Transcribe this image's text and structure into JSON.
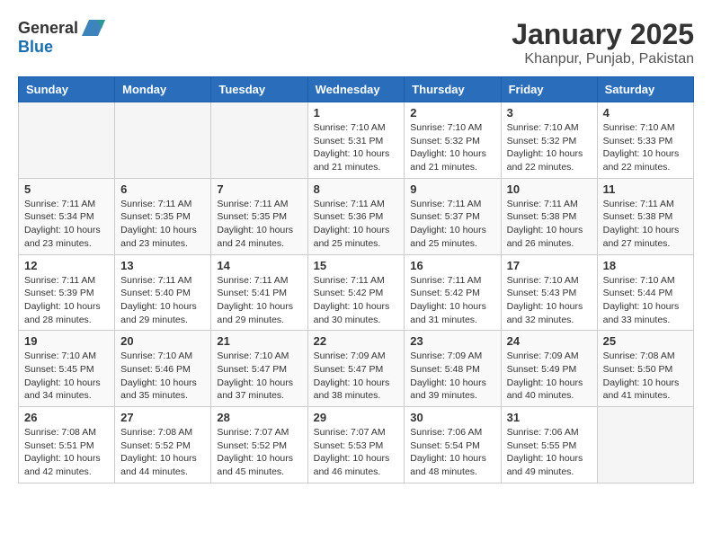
{
  "header": {
    "logo_general": "General",
    "logo_blue": "Blue",
    "title": "January 2025",
    "subtitle": "Khanpur, Punjab, Pakistan"
  },
  "weekdays": [
    "Sunday",
    "Monday",
    "Tuesday",
    "Wednesday",
    "Thursday",
    "Friday",
    "Saturday"
  ],
  "weeks": [
    [
      {
        "day": "",
        "info": ""
      },
      {
        "day": "",
        "info": ""
      },
      {
        "day": "",
        "info": ""
      },
      {
        "day": "1",
        "info": "Sunrise: 7:10 AM\nSunset: 5:31 PM\nDaylight: 10 hours\nand 21 minutes."
      },
      {
        "day": "2",
        "info": "Sunrise: 7:10 AM\nSunset: 5:32 PM\nDaylight: 10 hours\nand 21 minutes."
      },
      {
        "day": "3",
        "info": "Sunrise: 7:10 AM\nSunset: 5:32 PM\nDaylight: 10 hours\nand 22 minutes."
      },
      {
        "day": "4",
        "info": "Sunrise: 7:10 AM\nSunset: 5:33 PM\nDaylight: 10 hours\nand 22 minutes."
      }
    ],
    [
      {
        "day": "5",
        "info": "Sunrise: 7:11 AM\nSunset: 5:34 PM\nDaylight: 10 hours\nand 23 minutes."
      },
      {
        "day": "6",
        "info": "Sunrise: 7:11 AM\nSunset: 5:35 PM\nDaylight: 10 hours\nand 23 minutes."
      },
      {
        "day": "7",
        "info": "Sunrise: 7:11 AM\nSunset: 5:35 PM\nDaylight: 10 hours\nand 24 minutes."
      },
      {
        "day": "8",
        "info": "Sunrise: 7:11 AM\nSunset: 5:36 PM\nDaylight: 10 hours\nand 25 minutes."
      },
      {
        "day": "9",
        "info": "Sunrise: 7:11 AM\nSunset: 5:37 PM\nDaylight: 10 hours\nand 25 minutes."
      },
      {
        "day": "10",
        "info": "Sunrise: 7:11 AM\nSunset: 5:38 PM\nDaylight: 10 hours\nand 26 minutes."
      },
      {
        "day": "11",
        "info": "Sunrise: 7:11 AM\nSunset: 5:38 PM\nDaylight: 10 hours\nand 27 minutes."
      }
    ],
    [
      {
        "day": "12",
        "info": "Sunrise: 7:11 AM\nSunset: 5:39 PM\nDaylight: 10 hours\nand 28 minutes."
      },
      {
        "day": "13",
        "info": "Sunrise: 7:11 AM\nSunset: 5:40 PM\nDaylight: 10 hours\nand 29 minutes."
      },
      {
        "day": "14",
        "info": "Sunrise: 7:11 AM\nSunset: 5:41 PM\nDaylight: 10 hours\nand 29 minutes."
      },
      {
        "day": "15",
        "info": "Sunrise: 7:11 AM\nSunset: 5:42 PM\nDaylight: 10 hours\nand 30 minutes."
      },
      {
        "day": "16",
        "info": "Sunrise: 7:11 AM\nSunset: 5:42 PM\nDaylight: 10 hours\nand 31 minutes."
      },
      {
        "day": "17",
        "info": "Sunrise: 7:10 AM\nSunset: 5:43 PM\nDaylight: 10 hours\nand 32 minutes."
      },
      {
        "day": "18",
        "info": "Sunrise: 7:10 AM\nSunset: 5:44 PM\nDaylight: 10 hours\nand 33 minutes."
      }
    ],
    [
      {
        "day": "19",
        "info": "Sunrise: 7:10 AM\nSunset: 5:45 PM\nDaylight: 10 hours\nand 34 minutes."
      },
      {
        "day": "20",
        "info": "Sunrise: 7:10 AM\nSunset: 5:46 PM\nDaylight: 10 hours\nand 35 minutes."
      },
      {
        "day": "21",
        "info": "Sunrise: 7:10 AM\nSunset: 5:47 PM\nDaylight: 10 hours\nand 37 minutes."
      },
      {
        "day": "22",
        "info": "Sunrise: 7:09 AM\nSunset: 5:47 PM\nDaylight: 10 hours\nand 38 minutes."
      },
      {
        "day": "23",
        "info": "Sunrise: 7:09 AM\nSunset: 5:48 PM\nDaylight: 10 hours\nand 39 minutes."
      },
      {
        "day": "24",
        "info": "Sunrise: 7:09 AM\nSunset: 5:49 PM\nDaylight: 10 hours\nand 40 minutes."
      },
      {
        "day": "25",
        "info": "Sunrise: 7:08 AM\nSunset: 5:50 PM\nDaylight: 10 hours\nand 41 minutes."
      }
    ],
    [
      {
        "day": "26",
        "info": "Sunrise: 7:08 AM\nSunset: 5:51 PM\nDaylight: 10 hours\nand 42 minutes."
      },
      {
        "day": "27",
        "info": "Sunrise: 7:08 AM\nSunset: 5:52 PM\nDaylight: 10 hours\nand 44 minutes."
      },
      {
        "day": "28",
        "info": "Sunrise: 7:07 AM\nSunset: 5:52 PM\nDaylight: 10 hours\nand 45 minutes."
      },
      {
        "day": "29",
        "info": "Sunrise: 7:07 AM\nSunset: 5:53 PM\nDaylight: 10 hours\nand 46 minutes."
      },
      {
        "day": "30",
        "info": "Sunrise: 7:06 AM\nSunset: 5:54 PM\nDaylight: 10 hours\nand 48 minutes."
      },
      {
        "day": "31",
        "info": "Sunrise: 7:06 AM\nSunset: 5:55 PM\nDaylight: 10 hours\nand 49 minutes."
      },
      {
        "day": "",
        "info": ""
      }
    ]
  ]
}
